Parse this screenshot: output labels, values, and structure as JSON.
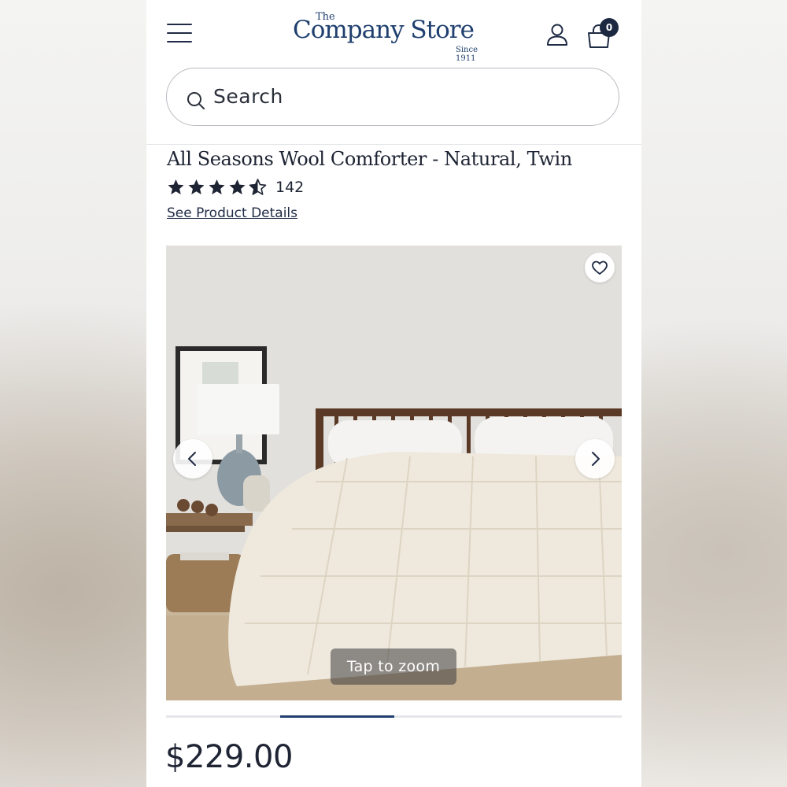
{
  "brand": {
    "logo_the": "The",
    "logo_main": "Company Store",
    "logo_since": "Since 1911",
    "color": "#1f3f6e"
  },
  "header": {
    "menu_icon": "hamburger-menu-icon",
    "account_icon": "user-icon",
    "cart_icon": "shopping-bag-icon",
    "cart_count": "0"
  },
  "search": {
    "placeholder": "Search",
    "icon": "search-icon"
  },
  "product": {
    "title": "All Seasons Wool Comforter - Natural, Twin",
    "rating": 4.5,
    "rating_max": 5,
    "review_count": "142",
    "details_link": "See Product Details",
    "price": "$229.00"
  },
  "gallery": {
    "zoom_hint": "Tap to zoom",
    "wishlist_icon": "heart-icon",
    "prev_icon": "chevron-left-icon",
    "next_icon": "chevron-right-icon",
    "image_alt": "Bedroom with white quilted comforter on wooden bed",
    "current_slide": 2,
    "total_slides": 4
  },
  "colors": {
    "text_dark": "#1e2433",
    "accent_navy": "#1f3f6e",
    "badge": "#1c2940"
  }
}
